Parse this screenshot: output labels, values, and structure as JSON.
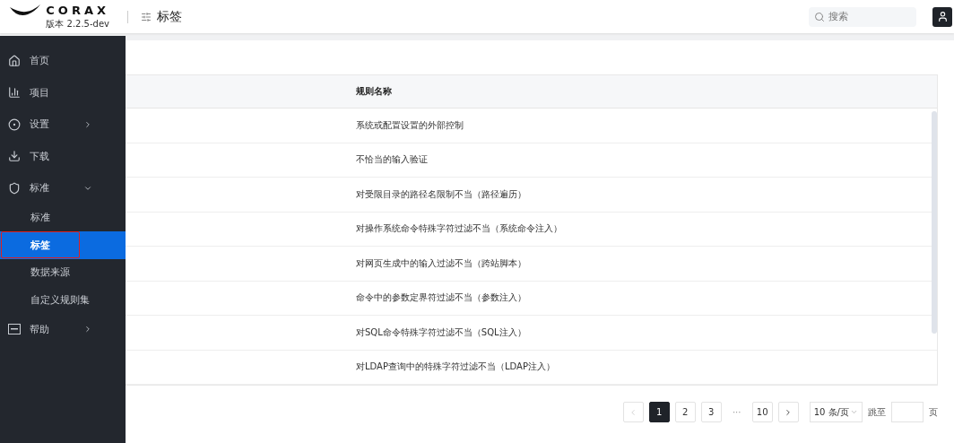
{
  "header": {
    "brand": "CORAX",
    "version": "版本 2.2.5-dev",
    "page_title": "标签",
    "search": {
      "placeholder": "搜索"
    }
  },
  "sidebar": {
    "items": [
      {
        "label": "首页",
        "kind": "link"
      },
      {
        "label": "项目",
        "kind": "link"
      },
      {
        "label": "设置",
        "kind": "group",
        "expanded": false
      },
      {
        "label": "下载",
        "kind": "link"
      },
      {
        "label": "标准",
        "kind": "group",
        "expanded": true,
        "children": [
          {
            "label": "标准",
            "selected": false,
            "annotated": false
          },
          {
            "label": "标签",
            "selected": true,
            "annotated": true
          },
          {
            "label": "数据来源",
            "selected": false,
            "annotated": false
          },
          {
            "label": "自定义规则集",
            "selected": false,
            "annotated": false
          }
        ]
      },
      {
        "label": "帮助",
        "kind": "group",
        "expanded": false
      }
    ]
  },
  "table": {
    "columns": [
      "规则名称"
    ],
    "rows": [
      "系统或配置设置的外部控制",
      "不恰当的输入验证",
      "对受限目录的路径名限制不当（路径遍历）",
      "对操作系统命令特殊字符过滤不当（系统命令注入）",
      "对网页生成中的输入过滤不当（跨站脚本）",
      "命令中的参数定界符过滤不当（参数注入）",
      "对SQL命令特殊字符过滤不当（SQL注入）",
      "对LDAP查询中的特殊字符过滤不当（LDAP注入）"
    ]
  },
  "pagination": {
    "prev_disabled": true,
    "pages": [
      {
        "label": "1",
        "kind": "page",
        "selected": true
      },
      {
        "label": "2",
        "kind": "page",
        "selected": false
      },
      {
        "label": "3",
        "kind": "page",
        "selected": false
      },
      {
        "label": "···",
        "kind": "ellipsis"
      },
      {
        "label": "10",
        "kind": "page",
        "selected": false
      }
    ],
    "page_size": "10 条/页",
    "jump_label": "跳至",
    "page_suffix": "页"
  }
}
